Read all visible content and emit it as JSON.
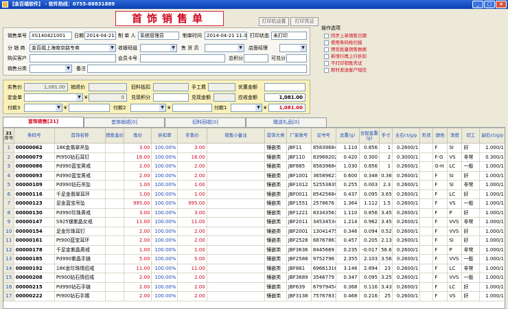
{
  "window": {
    "title": "【金百福软件】 - 软件热线：0755-88831889"
  },
  "header": {
    "big_title": "首饰销售单",
    "print_setup": "打印机设置",
    "print_voucher": "打印凭证"
  },
  "form": {
    "order_no_label": "销售单号",
    "order_no": "XS140421001",
    "date_label": "日期",
    "date": "2014-04-21",
    "maker_label": "制 单 人",
    "maker": "系统管理员",
    "make_time_label": "制单时间",
    "make_time": "2014-04-21 11:32",
    "print_status_label": "打印状态",
    "print_status": "未打印",
    "branch_label": "分 销 商",
    "branch": "金百福上海南京路专卖",
    "counter_group_label": "收银班组",
    "counter_group": "",
    "sales_clerk_label": "售 货 员",
    "sales_clerk": "",
    "manager_label": "店面经理",
    "manager": "",
    "customer_label": "购买客户",
    "customer": "",
    "member_card_label": "会员卡号",
    "member_card": "",
    "total_points_label": "总积分",
    "total_points": "",
    "available_points_label": "可兑分",
    "available_points": "",
    "sales_category_label": "销售分类",
    "sales_category": "",
    "remark_label": "备注",
    "remark": ""
  },
  "totals": {
    "actual_price_label": "实售价",
    "actual_price": "1,081.00",
    "refund_price_label": "销退价",
    "refund_price": "",
    "old_discount_label": "旧料抵扣",
    "old_discount": "",
    "labor_fee_label": "手工费",
    "labor_fee": "",
    "coupon_label": "优惠金额",
    "coupon": "",
    "deposit_label": "定金单",
    "deposit": "",
    "deposit_yen": "¥",
    "deposit_amount": "0",
    "redeem_points_label": "兑现积分",
    "redeem_points": "",
    "redeem_amount_label": "兑现金额",
    "redeem_amount": "",
    "receivable_label": "应收金额",
    "receivable": "1,081.00",
    "pay3_label": "付款3",
    "pay3": "",
    "pay3_yen": "¥",
    "pay2_label": "付款2",
    "pay2": "",
    "pay2_yen": "¥",
    "pay1_label": "付款1",
    "pay1": "",
    "pay1_yen": "¥",
    "pay1_amount": "1,081.00"
  },
  "options": {
    "title": "操作选项",
    "items": [
      "同步上单销售日期",
      "使用条码枪扫描",
      "预览批量销售数据",
      "新增行再上行折扣",
      "不打印销售凭证",
      "即时发送客户短信"
    ]
  },
  "tabs": [
    {
      "label": "首饰销售[21]",
      "active": true
    },
    {
      "label": "首饰销退[0]",
      "active": false
    },
    {
      "label": "旧料回收[0]",
      "active": false
    },
    {
      "label": "赠送礼品[0]",
      "active": false
    }
  ],
  "grid": {
    "row_count_header": "21",
    "row_count_sub": "序号",
    "columns": [
      "条码号",
      "首饰名称",
      "销售金价",
      "售价",
      "折扣率",
      "实售价",
      "销售小备注",
      "首饰大类",
      "厂家款号",
      "证书号",
      "总重(g)",
      "含配金重(g)",
      "手寸",
      "主石ct/g/p",
      "形状",
      "颜色",
      "净度",
      "切工",
      "副石ct/g/p"
    ],
    "rows": [
      [
        "00000062",
        "18K金翡翠吊坠",
        "",
        "3.00",
        "100.00%",
        "3.00",
        "",
        "镶嵌类",
        "JBF11",
        "85839684",
        "1.110",
        "0.856",
        "1",
        "0.2600/1",
        "",
        "F",
        "SI",
        "好",
        "1.000/1"
      ],
      [
        "00000079",
        "Pt950钻石耳钉",
        "",
        "16.00",
        "100.00%",
        "16.00",
        "",
        "镶嵌类",
        "JBF110",
        "83968202",
        "0.420",
        "0.300",
        "2",
        "0.3000/1",
        "",
        "F-G",
        "VS",
        "非常",
        "0.300/1"
      ],
      [
        "00000086",
        "Pd990蓝宝男戒",
        "",
        "2.00",
        "100.00%",
        "2.00",
        "",
        "镶嵌类",
        "JBF885",
        "85839684",
        "1.030",
        "0.856",
        "1",
        "0.2600/1",
        "",
        "G-H",
        "LC",
        "一般",
        "1.000/1"
      ],
      [
        "00000093",
        "Pd990蓝宝男戒",
        "",
        "2.00",
        "100.00%",
        "2.00",
        "",
        "镶嵌类",
        "JBF1001",
        "36589627",
        "0.600",
        "0.348",
        "0.36",
        "0.2600/1",
        "",
        "F",
        "SI",
        "好",
        "1.000/1"
      ],
      [
        "00000109",
        "Pd990钻石吊坠",
        "",
        "1.00",
        "100.00%",
        "1.00",
        "",
        "镶嵌类",
        "JBF1012",
        "52553839",
        "0.255",
        "0.003",
        "2.3",
        "0.2600/1",
        "",
        "F",
        "SI",
        "非常",
        "1.000/1"
      ],
      [
        "00000116",
        "千足金翡翠耳环",
        "",
        "1.00",
        "100.00%",
        "1.00",
        "",
        "镶嵌类",
        "JBF0011",
        "85425684",
        "0.437",
        "0.095",
        "3.65",
        "0.2600/1",
        "",
        "F",
        "LC",
        "好",
        "1.000/1"
      ],
      [
        "00000123",
        "足金蓝宝吊坠",
        "",
        "995.00",
        "100.00%",
        "995.00",
        "",
        "镶嵌类",
        "JBF1551",
        "2578676",
        "1.364",
        "1.112",
        "1.5",
        "0.2600/1",
        "",
        "F",
        "VS",
        "一般",
        "1.000/1"
      ],
      [
        "00000130",
        "Pd990珍珠男戒",
        "",
        "3.00",
        "100.00%",
        "3.00",
        "",
        "镶嵌类",
        "JBF1221",
        "83343563",
        "1.110",
        "0.856",
        "3.45",
        "0.2600/1",
        "",
        "F",
        "P",
        "好",
        "1.000/1"
      ],
      [
        "00000147",
        "S925银紫晶女戒",
        "",
        "11.00",
        "100.00%",
        "11.00",
        "",
        "镶嵌类",
        "JBF2011",
        "34534534",
        "1.214",
        "0.962",
        "3.45",
        "0.2600/1",
        "",
        "F",
        "VVS",
        "非常",
        "1.000/1"
      ],
      [
        "00000154",
        "足金珍珠耳钉",
        "",
        "2.00",
        "100.00%",
        "2.00",
        "",
        "镶嵌类",
        "JBF2001",
        "13041475",
        "0.346",
        "0.094",
        "0.52",
        "0.2600/1",
        "",
        "F",
        "VVS",
        "好",
        "1.000/1"
      ],
      [
        "00000161",
        "Pt900蓝宝耳环",
        "",
        "2.00",
        "100.00%",
        "2.00",
        "",
        "镶嵌类",
        "JBF2528",
        "68767861",
        "0.457",
        "0.205",
        "2.13",
        "0.2600/1",
        "",
        "F",
        "SI",
        "好",
        "1.000/1"
      ],
      [
        "00000178",
        "千足金紫晶男戒",
        "",
        "1.00",
        "100.00%",
        "1.00",
        "",
        "镶嵌类",
        "JBF3636",
        "8445669",
        "0.235",
        "-0.017",
        "56.6",
        "0.2600/1",
        "",
        "F",
        "P",
        "非常",
        "1.000/1"
      ],
      [
        "00000185",
        "Pd990紫晶手链",
        "",
        "5.00",
        "100.00%",
        "5.00",
        "",
        "镶嵌类",
        "JBF2588",
        "9752796",
        "2.355",
        "2.103",
        "3.56",
        "0.2600/1",
        "",
        "F",
        "VVS",
        "一般",
        "1.000/1"
      ],
      [
        "00000192",
        "18K金珍珠情侣戒",
        "",
        "11.00",
        "100.00%",
        "11.00",
        "",
        "镶嵌类",
        "JBF861",
        "69661316",
        "3.146",
        "2.894",
        "23",
        "0.2600/1",
        "",
        "F",
        "LC",
        "非常",
        "1.000/1"
      ],
      [
        "00000208",
        "Pt900钻石情侣戒",
        "",
        "2.00",
        "100.00%",
        "2.00",
        "",
        "镶嵌类",
        "JBF3689",
        "3546779",
        "0.347",
        "0.095",
        "3.256",
        "0.2600/1",
        "",
        "F",
        "VVS",
        "一般",
        "1.000/1"
      ],
      [
        "00000215",
        "Pd990钻石手链",
        "",
        "2.00",
        "100.00%",
        "2.00",
        "",
        "镶嵌类",
        "JBF639",
        "67979454",
        "0.368",
        "0.116",
        "3.43",
        "0.2600/1",
        "",
        "F",
        "LC",
        "好",
        "1.000/1"
      ],
      [
        "00000222",
        "Pt900钻石手镯",
        "",
        "2.00",
        "100.00%",
        "2.00",
        "",
        "镶嵌类",
        "JBF3138",
        "75767831",
        "0.468",
        "0.216",
        "25",
        "0.2600/1",
        "",
        "F",
        "VS",
        "好",
        "1.000/1"
      ]
    ]
  }
}
